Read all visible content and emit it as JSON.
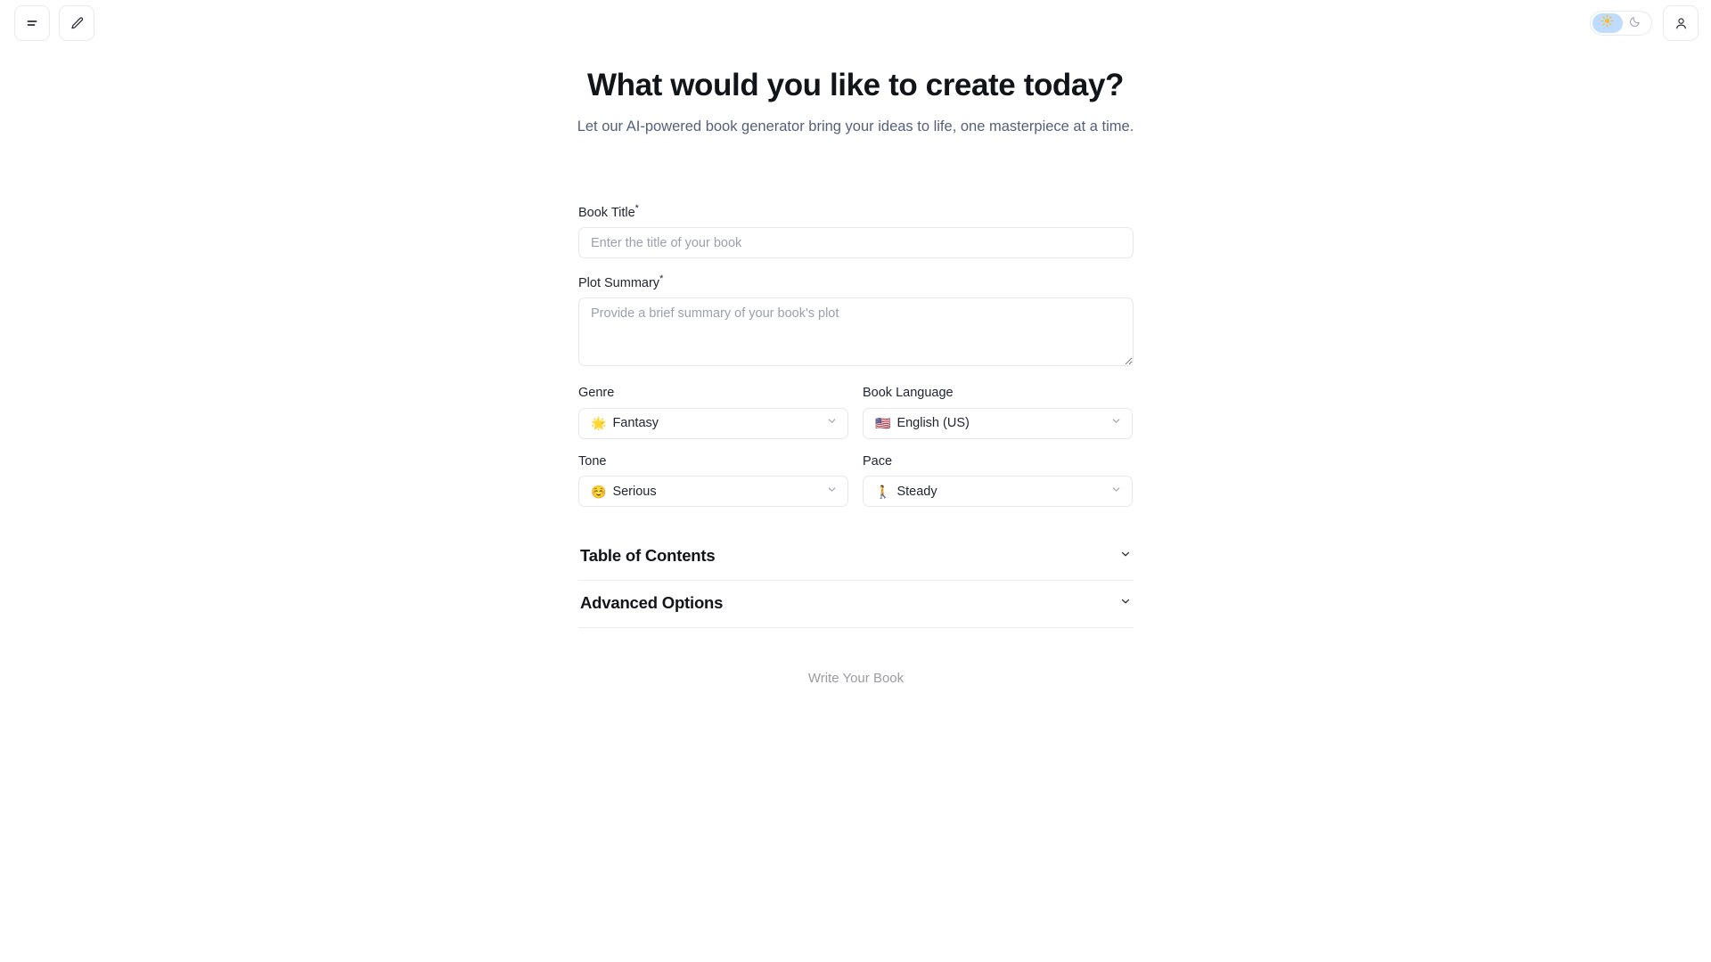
{
  "topbar": {
    "left_buttons": [
      {
        "name": "menu-icon",
        "label": "Menu"
      },
      {
        "name": "edit-icon",
        "label": "Edit"
      }
    ],
    "theme_toggle": {
      "light_icon": "sun-icon",
      "dark_icon": "moon-icon",
      "active": "light",
      "active_color": "#bfdbfe",
      "sun_color": "#fbbf24",
      "moon_color": "#9aa1ad"
    },
    "account_button": {
      "name": "user-icon",
      "label": "Account"
    }
  },
  "hero": {
    "title": "What would you like to create today?",
    "subtitle": "Let our AI-powered book generator bring your ideas to life, one masterpiece at a time."
  },
  "form": {
    "book_title": {
      "label": "Book Title",
      "required_marker": "*",
      "placeholder": "Enter the title of your book",
      "value": ""
    },
    "plot_summary": {
      "label": "Plot Summary",
      "required_marker": "*",
      "placeholder": "Provide a brief summary of your book's plot",
      "value": ""
    },
    "genre": {
      "label": "Genre",
      "emoji": "🌟",
      "value": "Fantasy"
    },
    "book_language": {
      "label": "Book Language",
      "emoji": "🇺🇸",
      "value": "English (US)"
    },
    "tone": {
      "label": "Tone",
      "emoji": "☺️",
      "value": "Serious"
    },
    "pace": {
      "label": "Pace",
      "emoji": "🚶",
      "value": "Steady"
    },
    "accordions": [
      {
        "label": "Table of Contents",
        "expanded": false
      },
      {
        "label": "Advanced Options",
        "expanded": false
      }
    ],
    "submit": {
      "label": "Write Your Book",
      "disabled": true,
      "text_color": "#9b9ba1"
    }
  }
}
